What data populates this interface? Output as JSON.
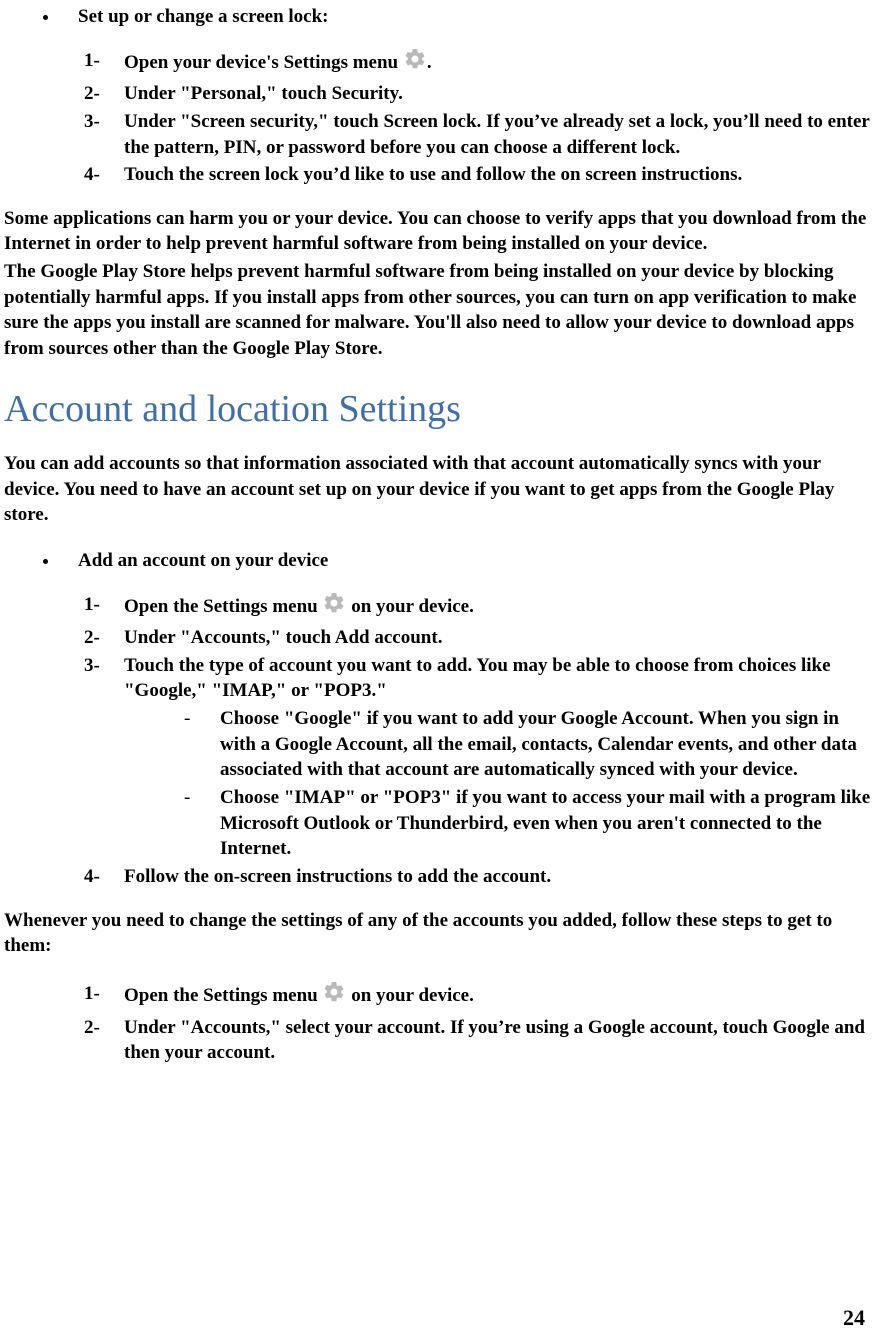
{
  "screenLock": {
    "heading": "Set up or change a screen lock:",
    "steps": [
      {
        "pre": "Open your device's Settings menu ",
        "post": "."
      },
      {
        "text": "Under \"Personal,\" touch Security."
      },
      {
        "text": "Under \"Screen security,\" touch Screen lock. If you’ve already set a lock, you’ll need to enter the pattern, PIN, or password before you can choose a different lock."
      },
      {
        "text": "Touch the screen lock you’d like to use and follow the on screen instructions."
      }
    ]
  },
  "harmPara1": "Some applications can harm you or your device. You can choose to verify apps that you download from the Internet in order to help prevent harmful software from being installed on your device.",
  "harmPara2": "The Google Play Store helps prevent harmful software from being installed on your device by blocking potentially harmful apps. If you install apps from other sources, you can turn on app verification to make sure the apps you install are scanned for malware. You'll also need to allow your device to download apps from sources other than the Google Play Store.",
  "sectionHeading": "Account and location Settings",
  "accountsIntro": "You can add accounts so that information associated with that account automatically syncs with your device. You need to have an account set up on your device if you want to get apps from the Google Play store.",
  "addAccount": {
    "heading": "Add an account on your device",
    "steps": [
      {
        "pre": "Open the Settings menu ",
        "post": " on your device."
      },
      {
        "text": "Under \"Accounts,\" touch Add account."
      },
      {
        "text": "Touch the type of account you want to add. You may be able to choose from choices like \"Google,\" \"IMAP,\" or \"POP3.\"",
        "sub": [
          "Choose \"Google\" if you want to add your Google Account. When you sign in with a Google Account, all the email, contacts, Calendar events, and other data associated with that account are automatically synced with your device.",
          "Choose \"IMAP\" or \"POP3\" if you want to access your mail with a program like Microsoft Outlook or Thunderbird, even when you aren't connected to the Internet."
        ]
      },
      {
        "text": "Follow the on-screen instructions to add the account."
      }
    ]
  },
  "changeIntro": "Whenever you need to change the settings of any of the accounts you added, follow these steps to get to them:",
  "changeSteps": [
    {
      "pre": "Open the Settings menu ",
      "post": " on your device."
    },
    {
      "text": "Under \"Accounts,\" select your account. If you’re using a Google account, touch Google and then your account."
    }
  ],
  "pageNumber": "24"
}
